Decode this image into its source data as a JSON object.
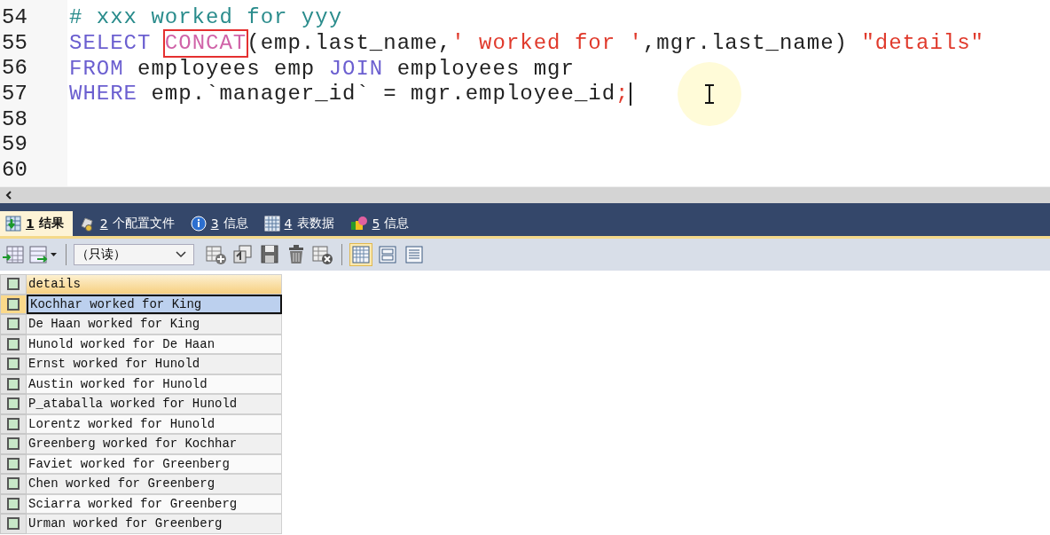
{
  "editor": {
    "lines": [
      {
        "number": "54",
        "tokens": [
          {
            "kind": "comment",
            "text": "# xxx worked for yyy",
            "boxed": false
          }
        ]
      },
      {
        "number": "55",
        "tokens": [
          {
            "kind": "keyword",
            "text": "SELECT ",
            "boxed": false
          },
          {
            "kind": "function",
            "text": "CONCAT",
            "boxed": true
          },
          {
            "kind": "plain",
            "text": "(emp.last_name,",
            "boxed": false
          },
          {
            "kind": "string",
            "text": "' worked for '",
            "boxed": false
          },
          {
            "kind": "plain",
            "text": ",mgr.last_name) ",
            "boxed": false
          },
          {
            "kind": "string",
            "text": "\"details\"",
            "boxed": false
          }
        ]
      },
      {
        "number": "56",
        "tokens": [
          {
            "kind": "keyword",
            "text": "FROM",
            "boxed": false
          },
          {
            "kind": "plain",
            "text": " employees emp ",
            "boxed": false
          },
          {
            "kind": "keyword",
            "text": "JOIN",
            "boxed": false
          },
          {
            "kind": "plain",
            "text": " employees mgr",
            "boxed": false
          }
        ]
      },
      {
        "number": "57",
        "caret": true,
        "tokens": [
          {
            "kind": "keyword",
            "text": "WHERE",
            "boxed": false
          },
          {
            "kind": "plain",
            "text": " emp.`manager_id` = mgr.employee_id",
            "boxed": false
          },
          {
            "kind": "string",
            "text": ";",
            "boxed": false
          }
        ]
      },
      {
        "number": "58"
      },
      {
        "number": "59"
      },
      {
        "number": "60"
      }
    ]
  },
  "tabs": [
    {
      "kind": "result",
      "key": "1",
      "label": "结果",
      "selected": true
    },
    {
      "kind": "profile",
      "key": "2",
      "label": "个配置文件",
      "selected": false
    },
    {
      "kind": "info",
      "key": "3",
      "label": "信息",
      "selected": false
    },
    {
      "kind": "table",
      "key": "4",
      "label": "表数据",
      "selected": false
    },
    {
      "kind": "info2",
      "key": "5",
      "label": "信息",
      "selected": false
    }
  ],
  "toolbar": {
    "mode_select": "（只读）",
    "view_modes": [
      {
        "kind": "grid",
        "selected": true
      },
      {
        "kind": "form",
        "selected": false
      },
      {
        "kind": "text",
        "selected": false
      }
    ]
  },
  "grid": {
    "columns": [
      "details"
    ],
    "rows": [
      {
        "cells": [
          "Kochhar worked for King"
        ],
        "selected": true
      },
      {
        "cells": [
          "De Haan worked for King"
        ],
        "selected": false
      },
      {
        "cells": [
          "Hunold worked for De Haan"
        ],
        "selected": false
      },
      {
        "cells": [
          "Ernst worked for Hunold"
        ],
        "selected": false
      },
      {
        "cells": [
          "Austin worked for Hunold"
        ],
        "selected": false
      },
      {
        "cells": [
          "P_ataballa worked for Hunold"
        ],
        "selected": false
      },
      {
        "cells": [
          "Lorentz worked for Hunold"
        ],
        "selected": false
      },
      {
        "cells": [
          "Greenberg worked for Kochhar"
        ],
        "selected": false
      },
      {
        "cells": [
          "Faviet worked for Greenberg"
        ],
        "selected": false
      },
      {
        "cells": [
          "Chen worked for Greenberg"
        ],
        "selected": false
      },
      {
        "cells": [
          "Sciarra worked for Greenberg"
        ],
        "selected": false
      },
      {
        "cells": [
          "Urman worked for Greenberg"
        ],
        "selected": false
      }
    ]
  }
}
